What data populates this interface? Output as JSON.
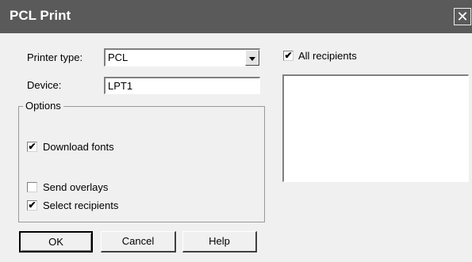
{
  "window": {
    "title": "PCL Print",
    "close_glyph": "✕"
  },
  "printer_type": {
    "label": "Printer type:",
    "value": "PCL"
  },
  "device": {
    "label": "Device:",
    "value": "LPT1"
  },
  "options": {
    "legend": "Options",
    "download_fonts": {
      "label": "Download fonts",
      "checked": true
    },
    "send_overlays": {
      "label": "Send overlays",
      "checked": false
    },
    "select_recipients": {
      "label": "Select recipients",
      "checked": true
    }
  },
  "all_recipients": {
    "label": "All recipients",
    "checked": true
  },
  "buttons": {
    "ok": "OK",
    "cancel": "Cancel",
    "help": "Help"
  },
  "check_glyph": "✔",
  "icons": {
    "close": "close-icon",
    "dropdown": "chevron-down-icon"
  }
}
